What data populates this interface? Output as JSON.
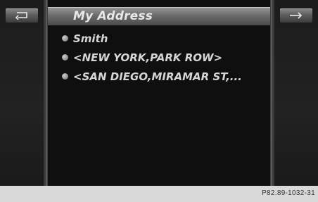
{
  "header": {
    "title": "My Address"
  },
  "left_button": {
    "icon": "back-arrow-icon"
  },
  "right_button": {
    "icon": "enter-arrow-icon"
  },
  "list": {
    "items": [
      {
        "icon": "address-entry-icon",
        "label": "Smith"
      },
      {
        "icon": "address-entry-icon",
        "label": "<NEW YORK,PARK ROW>"
      },
      {
        "icon": "address-entry-icon",
        "label": "<SAN DIEGO,MIRAMAR ST,..."
      }
    ]
  },
  "footer": {
    "code": "P82.89-1032-31"
  },
  "colors": {
    "background": "#151515",
    "button": "#6c6c6c",
    "text": "#d6d6d6",
    "footer": "#d9d9d9"
  }
}
